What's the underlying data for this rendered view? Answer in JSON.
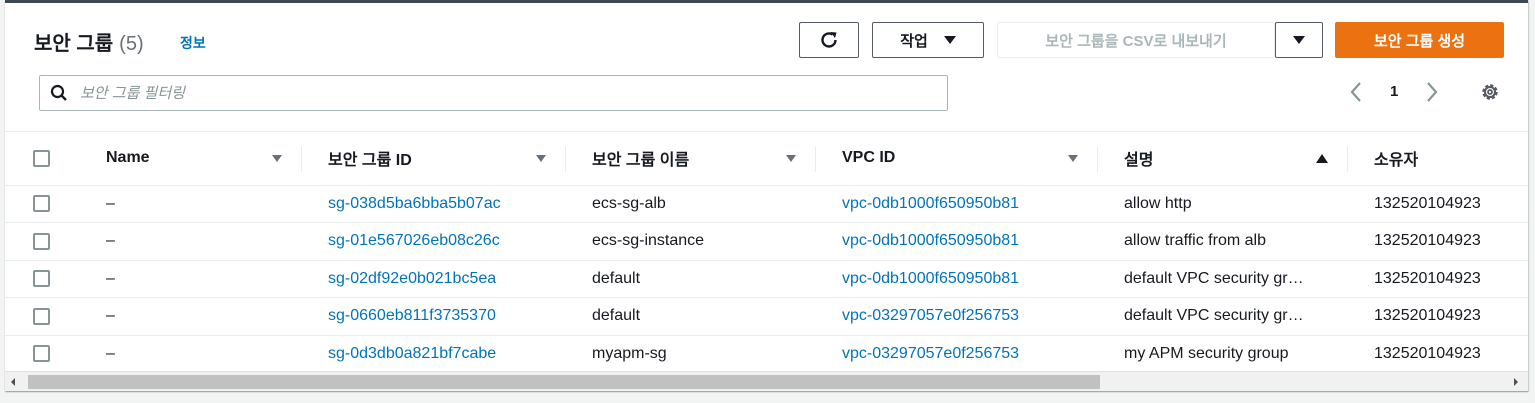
{
  "header": {
    "title": "보안 그룹",
    "count": "(5)",
    "info_link": "정보"
  },
  "toolbar": {
    "actions_label": "작업",
    "export_label": "보안 그룹을 CSV로 내보내기",
    "create_label": "보안 그룹 생성"
  },
  "search": {
    "placeholder": "보안 그룹 필터링"
  },
  "pagination": {
    "current_page": "1"
  },
  "table": {
    "columns": [
      "Name",
      "보안 그룹 ID",
      "보안 그룹 이름",
      "VPC ID",
      "설명",
      "소유자"
    ],
    "rows": [
      {
        "name": "–",
        "sg_id": "sg-038d5ba6bba5b07ac",
        "sg_name": "ecs-sg-alb",
        "vpc_id": "vpc-0db1000f650950b81",
        "description": "allow http",
        "owner": "132520104923"
      },
      {
        "name": "–",
        "sg_id": "sg-01e567026eb08c26c",
        "sg_name": "ecs-sg-instance",
        "vpc_id": "vpc-0db1000f650950b81",
        "description": "allow traffic from alb",
        "owner": "132520104923"
      },
      {
        "name": "–",
        "sg_id": "sg-02df92e0b021bc5ea",
        "sg_name": "default",
        "vpc_id": "vpc-0db1000f650950b81",
        "description": "default VPC security gr…",
        "owner": "132520104923"
      },
      {
        "name": "–",
        "sg_id": "sg-0660eb811f3735370",
        "sg_name": "default",
        "vpc_id": "vpc-03297057e0f256753",
        "description": "default VPC security gr…",
        "owner": "132520104923"
      },
      {
        "name": "–",
        "sg_id": "sg-0d3db0a821bf7cabe",
        "sg_name": "myapm-sg",
        "vpc_id": "vpc-03297057e0f256753",
        "description": "my APM security group",
        "owner": "132520104923"
      }
    ]
  },
  "colors": {
    "primary": "#ec7211",
    "link": "#0073bb",
    "text": "#16191f"
  }
}
